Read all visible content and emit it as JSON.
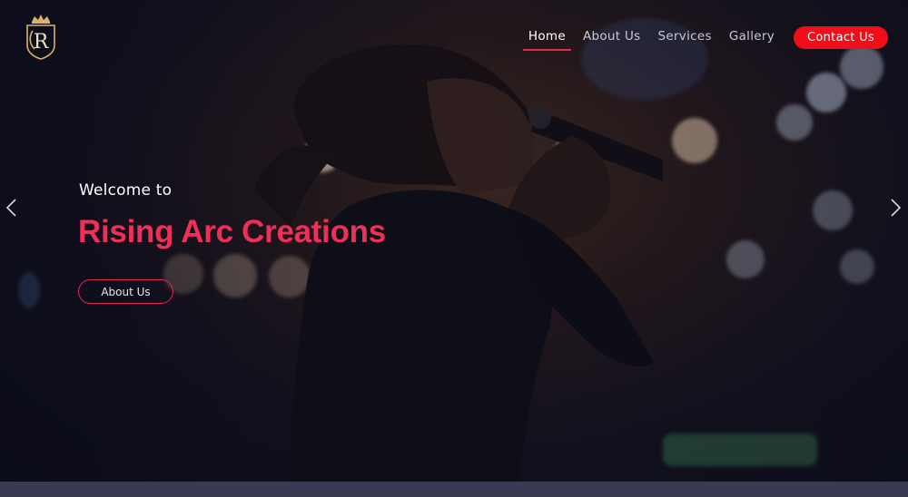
{
  "brand": {
    "logo_icon": "crown-monogram-logo-icon",
    "monogram": "R"
  },
  "nav": {
    "items": [
      {
        "label": "Home",
        "active": true
      },
      {
        "label": "About Us",
        "active": false
      },
      {
        "label": "Services",
        "active": false
      },
      {
        "label": "Gallery",
        "active": false
      }
    ],
    "contact_label": "Contact Us"
  },
  "hero": {
    "welcome": "Welcome to",
    "title": "Rising Arc Creations",
    "cta_label": "About Us",
    "prev_icon": "chevron-left-icon",
    "next_icon": "chevron-right-icon"
  },
  "colors": {
    "accent": "#ee2f58",
    "contact_button": "#f20e18",
    "nav_text": "#c9c9d2",
    "bottom_bar": "#383b52"
  }
}
